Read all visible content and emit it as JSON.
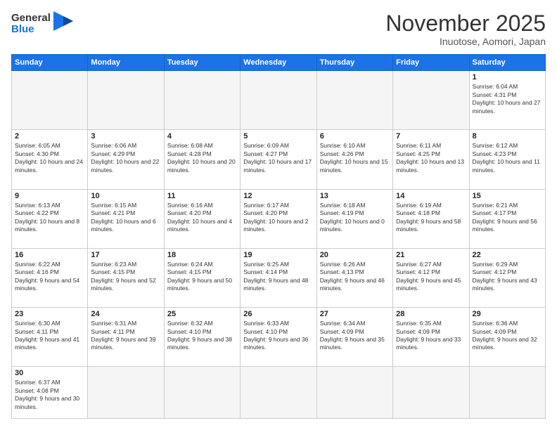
{
  "header": {
    "logo_general": "General",
    "logo_blue": "Blue",
    "month_title": "November 2025",
    "location": "Inuotose, Aomori, Japan"
  },
  "days_of_week": [
    "Sunday",
    "Monday",
    "Tuesday",
    "Wednesday",
    "Thursday",
    "Friday",
    "Saturday"
  ],
  "weeks": [
    [
      {
        "day": "",
        "empty": true
      },
      {
        "day": "",
        "empty": true
      },
      {
        "day": "",
        "empty": true
      },
      {
        "day": "",
        "empty": true
      },
      {
        "day": "",
        "empty": true
      },
      {
        "day": "",
        "empty": true
      },
      {
        "day": "1",
        "sunrise": "6:04 AM",
        "sunset": "4:31 PM",
        "daylight": "10 hours and 27 minutes."
      }
    ],
    [
      {
        "day": "2",
        "sunrise": "6:05 AM",
        "sunset": "4:30 PM",
        "daylight": "10 hours and 24 minutes."
      },
      {
        "day": "3",
        "sunrise": "6:06 AM",
        "sunset": "4:29 PM",
        "daylight": "10 hours and 22 minutes."
      },
      {
        "day": "4",
        "sunrise": "6:08 AM",
        "sunset": "4:28 PM",
        "daylight": "10 hours and 20 minutes."
      },
      {
        "day": "5",
        "sunrise": "6:09 AM",
        "sunset": "4:27 PM",
        "daylight": "10 hours and 17 minutes."
      },
      {
        "day": "6",
        "sunrise": "6:10 AM",
        "sunset": "4:26 PM",
        "daylight": "10 hours and 15 minutes."
      },
      {
        "day": "7",
        "sunrise": "6:11 AM",
        "sunset": "4:25 PM",
        "daylight": "10 hours and 13 minutes."
      },
      {
        "day": "8",
        "sunrise": "6:12 AM",
        "sunset": "4:23 PM",
        "daylight": "10 hours and 11 minutes."
      }
    ],
    [
      {
        "day": "9",
        "sunrise": "6:13 AM",
        "sunset": "4:22 PM",
        "daylight": "10 hours and 8 minutes."
      },
      {
        "day": "10",
        "sunrise": "6:15 AM",
        "sunset": "4:21 PM",
        "daylight": "10 hours and 6 minutes."
      },
      {
        "day": "11",
        "sunrise": "6:16 AM",
        "sunset": "4:20 PM",
        "daylight": "10 hours and 4 minutes."
      },
      {
        "day": "12",
        "sunrise": "6:17 AM",
        "sunset": "4:20 PM",
        "daylight": "10 hours and 2 minutes."
      },
      {
        "day": "13",
        "sunrise": "6:18 AM",
        "sunset": "4:19 PM",
        "daylight": "10 hours and 0 minutes."
      },
      {
        "day": "14",
        "sunrise": "6:19 AM",
        "sunset": "4:18 PM",
        "daylight": "9 hours and 58 minutes."
      },
      {
        "day": "15",
        "sunrise": "6:21 AM",
        "sunset": "4:17 PM",
        "daylight": "9 hours and 56 minutes."
      }
    ],
    [
      {
        "day": "16",
        "sunrise": "6:22 AM",
        "sunset": "4:16 PM",
        "daylight": "9 hours and 54 minutes."
      },
      {
        "day": "17",
        "sunrise": "6:23 AM",
        "sunset": "4:15 PM",
        "daylight": "9 hours and 52 minutes."
      },
      {
        "day": "18",
        "sunrise": "6:24 AM",
        "sunset": "4:15 PM",
        "daylight": "9 hours and 50 minutes."
      },
      {
        "day": "19",
        "sunrise": "6:25 AM",
        "sunset": "4:14 PM",
        "daylight": "9 hours and 48 minutes."
      },
      {
        "day": "20",
        "sunrise": "6:26 AM",
        "sunset": "4:13 PM",
        "daylight": "9 hours and 46 minutes."
      },
      {
        "day": "21",
        "sunrise": "6:27 AM",
        "sunset": "4:12 PM",
        "daylight": "9 hours and 45 minutes."
      },
      {
        "day": "22",
        "sunrise": "6:29 AM",
        "sunset": "4:12 PM",
        "daylight": "9 hours and 43 minutes."
      }
    ],
    [
      {
        "day": "23",
        "sunrise": "6:30 AM",
        "sunset": "4:11 PM",
        "daylight": "9 hours and 41 minutes."
      },
      {
        "day": "24",
        "sunrise": "6:31 AM",
        "sunset": "4:11 PM",
        "daylight": "9 hours and 39 minutes."
      },
      {
        "day": "25",
        "sunrise": "6:32 AM",
        "sunset": "4:10 PM",
        "daylight": "9 hours and 38 minutes."
      },
      {
        "day": "26",
        "sunrise": "6:33 AM",
        "sunset": "4:10 PM",
        "daylight": "9 hours and 36 minutes."
      },
      {
        "day": "27",
        "sunrise": "6:34 AM",
        "sunset": "4:09 PM",
        "daylight": "9 hours and 35 minutes."
      },
      {
        "day": "28",
        "sunrise": "6:35 AM",
        "sunset": "4:09 PM",
        "daylight": "9 hours and 33 minutes."
      },
      {
        "day": "29",
        "sunrise": "6:36 AM",
        "sunset": "4:09 PM",
        "daylight": "9 hours and 32 minutes."
      }
    ],
    [
      {
        "day": "30",
        "sunrise": "6:37 AM",
        "sunset": "4:08 PM",
        "daylight": "9 hours and 30 minutes."
      },
      {
        "day": "",
        "empty": true
      },
      {
        "day": "",
        "empty": true
      },
      {
        "day": "",
        "empty": true
      },
      {
        "day": "",
        "empty": true
      },
      {
        "day": "",
        "empty": true
      },
      {
        "day": "",
        "empty": true
      }
    ]
  ]
}
